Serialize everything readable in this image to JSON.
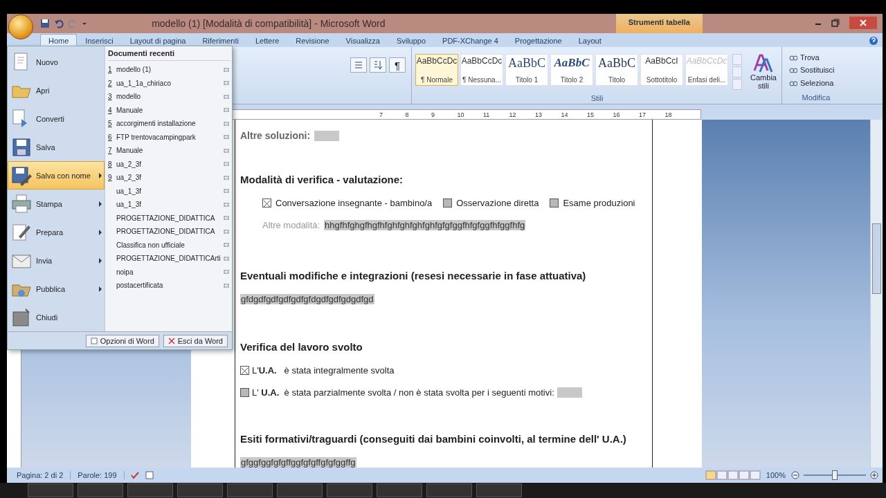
{
  "window": {
    "title": "modello (1) [Modalità di compatibilità] - Microsoft Word",
    "context_tab": "Strumenti tabella"
  },
  "ribbon_tabs": [
    {
      "label": "Home",
      "selected": true
    },
    {
      "label": "Inserisci",
      "selected": false
    },
    {
      "label": "Layout di pagina",
      "selected": false
    },
    {
      "label": "Riferimenti",
      "selected": false
    },
    {
      "label": "Lettere",
      "selected": false
    },
    {
      "label": "Revisione",
      "selected": false
    },
    {
      "label": "Visualizza",
      "selected": false
    },
    {
      "label": "Sviluppo",
      "selected": false
    },
    {
      "label": "PDF-XChange 4",
      "selected": false
    },
    {
      "label": "Progettazione",
      "selected": false
    },
    {
      "label": "Layout",
      "selected": false
    }
  ],
  "paragraph_group": {
    "show_marks": "¶"
  },
  "styles": {
    "label": "Stili",
    "change_styles": "Cambia stili",
    "items": [
      {
        "preview": "AaBbCcDc",
        "name": "¶ Normale",
        "kind": "normal",
        "selected": true
      },
      {
        "preview": "AaBbCcDc",
        "name": "¶ Nessuna...",
        "kind": "normal",
        "selected": false
      },
      {
        "preview": "AaBbC",
        "name": "Titolo 1",
        "kind": "title1",
        "selected": false
      },
      {
        "preview": "AaBbC",
        "name": "Titolo 2",
        "kind": "title2",
        "selected": false
      },
      {
        "preview": "AaBbC",
        "name": "Titolo",
        "kind": "title",
        "selected": false
      },
      {
        "preview": "AaBbCcI",
        "name": "Sottotitolo",
        "kind": "subtitle",
        "selected": false
      },
      {
        "preview": "AaBbCcDc",
        "name": "Enfasi deli...",
        "kind": "emphasis",
        "selected": false
      }
    ]
  },
  "edit_group": {
    "label": "Modifica",
    "items": [
      "Trova",
      "Sostituisci",
      "Seleziona"
    ]
  },
  "ruler": [
    "7",
    "8",
    "9",
    "10",
    "11",
    "12",
    "13",
    "14",
    "15",
    "16",
    "17",
    "18"
  ],
  "office_menu": {
    "items": [
      {
        "label": "Nuovo",
        "submenu": false,
        "selected": false
      },
      {
        "label": "Apri",
        "submenu": false,
        "selected": false
      },
      {
        "label": "Converti",
        "submenu": false,
        "selected": false
      },
      {
        "label": "Salva",
        "submenu": false,
        "selected": false
      },
      {
        "label": "Salva con nome",
        "submenu": true,
        "selected": true
      },
      {
        "label": "Stampa",
        "submenu": true,
        "selected": false
      },
      {
        "label": "Prepara",
        "submenu": true,
        "selected": false
      },
      {
        "label": "Invia",
        "submenu": true,
        "selected": false
      },
      {
        "label": "Pubblica",
        "submenu": true,
        "selected": false
      },
      {
        "label": "Chiudi",
        "submenu": false,
        "selected": false
      }
    ],
    "recent_title": "Documenti recenti",
    "recent": [
      {
        "index": "1",
        "name": "modello (1)"
      },
      {
        "index": "2",
        "name": "ua_1_1a_chiriaco"
      },
      {
        "index": "3",
        "name": "modello"
      },
      {
        "index": "4",
        "name": "Manuale"
      },
      {
        "index": "5",
        "name": "accorgimenti installazione"
      },
      {
        "index": "6",
        "name": "FTP trentovacampingpark"
      },
      {
        "index": "7",
        "name": "Manuale"
      },
      {
        "index": "8",
        "name": "ua_2_3f"
      },
      {
        "index": "9",
        "name": "ua_2_3f"
      },
      {
        "name": "ua_1_3f"
      },
      {
        "name": "ua_1_3f"
      },
      {
        "name": "PROGETTAZIONE_DIDATTICA"
      },
      {
        "name": "PROGETTAZIONE_DIDATTICA"
      },
      {
        "name": "Classifica non ufficiale"
      },
      {
        "name": "PROGETTAZIONE_DIDATTICArti"
      },
      {
        "name": "noipa"
      },
      {
        "name": "postacertificata"
      }
    ],
    "buttons": [
      "Opzioni di Word",
      "Esci da Word"
    ]
  },
  "document": {
    "blocks": [
      {
        "kind": "label_field",
        "text": "Altre soluzioni:"
      },
      {
        "kind": "heading",
        "text": "Modalità di verifica - valutazione:"
      },
      {
        "kind": "options",
        "options": [
          {
            "label": "Conversazione insegnante - bambino/a",
            "checked": true
          },
          {
            "label": "Osservazione diretta",
            "checked": false
          },
          {
            "label": "Esame produzioni",
            "checked": false
          }
        ]
      },
      {
        "kind": "text_field",
        "text": "Altre modalità:",
        "value": "hhgfhfghgfhgfhfghfghfghfghfgfgfggfhfgfggfhfggfhfg"
      },
      {
        "kind": "heading",
        "text": "Eventuali modifiche e integrazioni (resesi necessarie in fase attuativa)"
      },
      {
        "kind": "field",
        "value": "gfdgdfgdfgdfgdfgfdgdfgdfgdgdfgd"
      },
      {
        "kind": "heading",
        "text": "Verifica del lavoro svolto"
      },
      {
        "kind": "check",
        "text": "L'**U.A.**   è stata integralmente svolta",
        "checked": true,
        "blank": false
      },
      {
        "kind": "check",
        "text": "L' **U.A.**  è stata parzialmente svolta / non è stata svolta per i seguenti motivi:",
        "checked": false,
        "blank": true
      },
      {
        "kind": "heading",
        "text": "Esiti formativi/traguardi (conseguiti dai bambini coinvolti, al termine dell' U.A.)"
      },
      {
        "kind": "field",
        "value": "gfggfggfgfgffggfgfgffgfgfggffg"
      }
    ]
  },
  "status_bar": {
    "page": "Pagina: 2 di 2",
    "words": "Parole: 199",
    "zoom": "100%",
    "level": 0.5
  }
}
